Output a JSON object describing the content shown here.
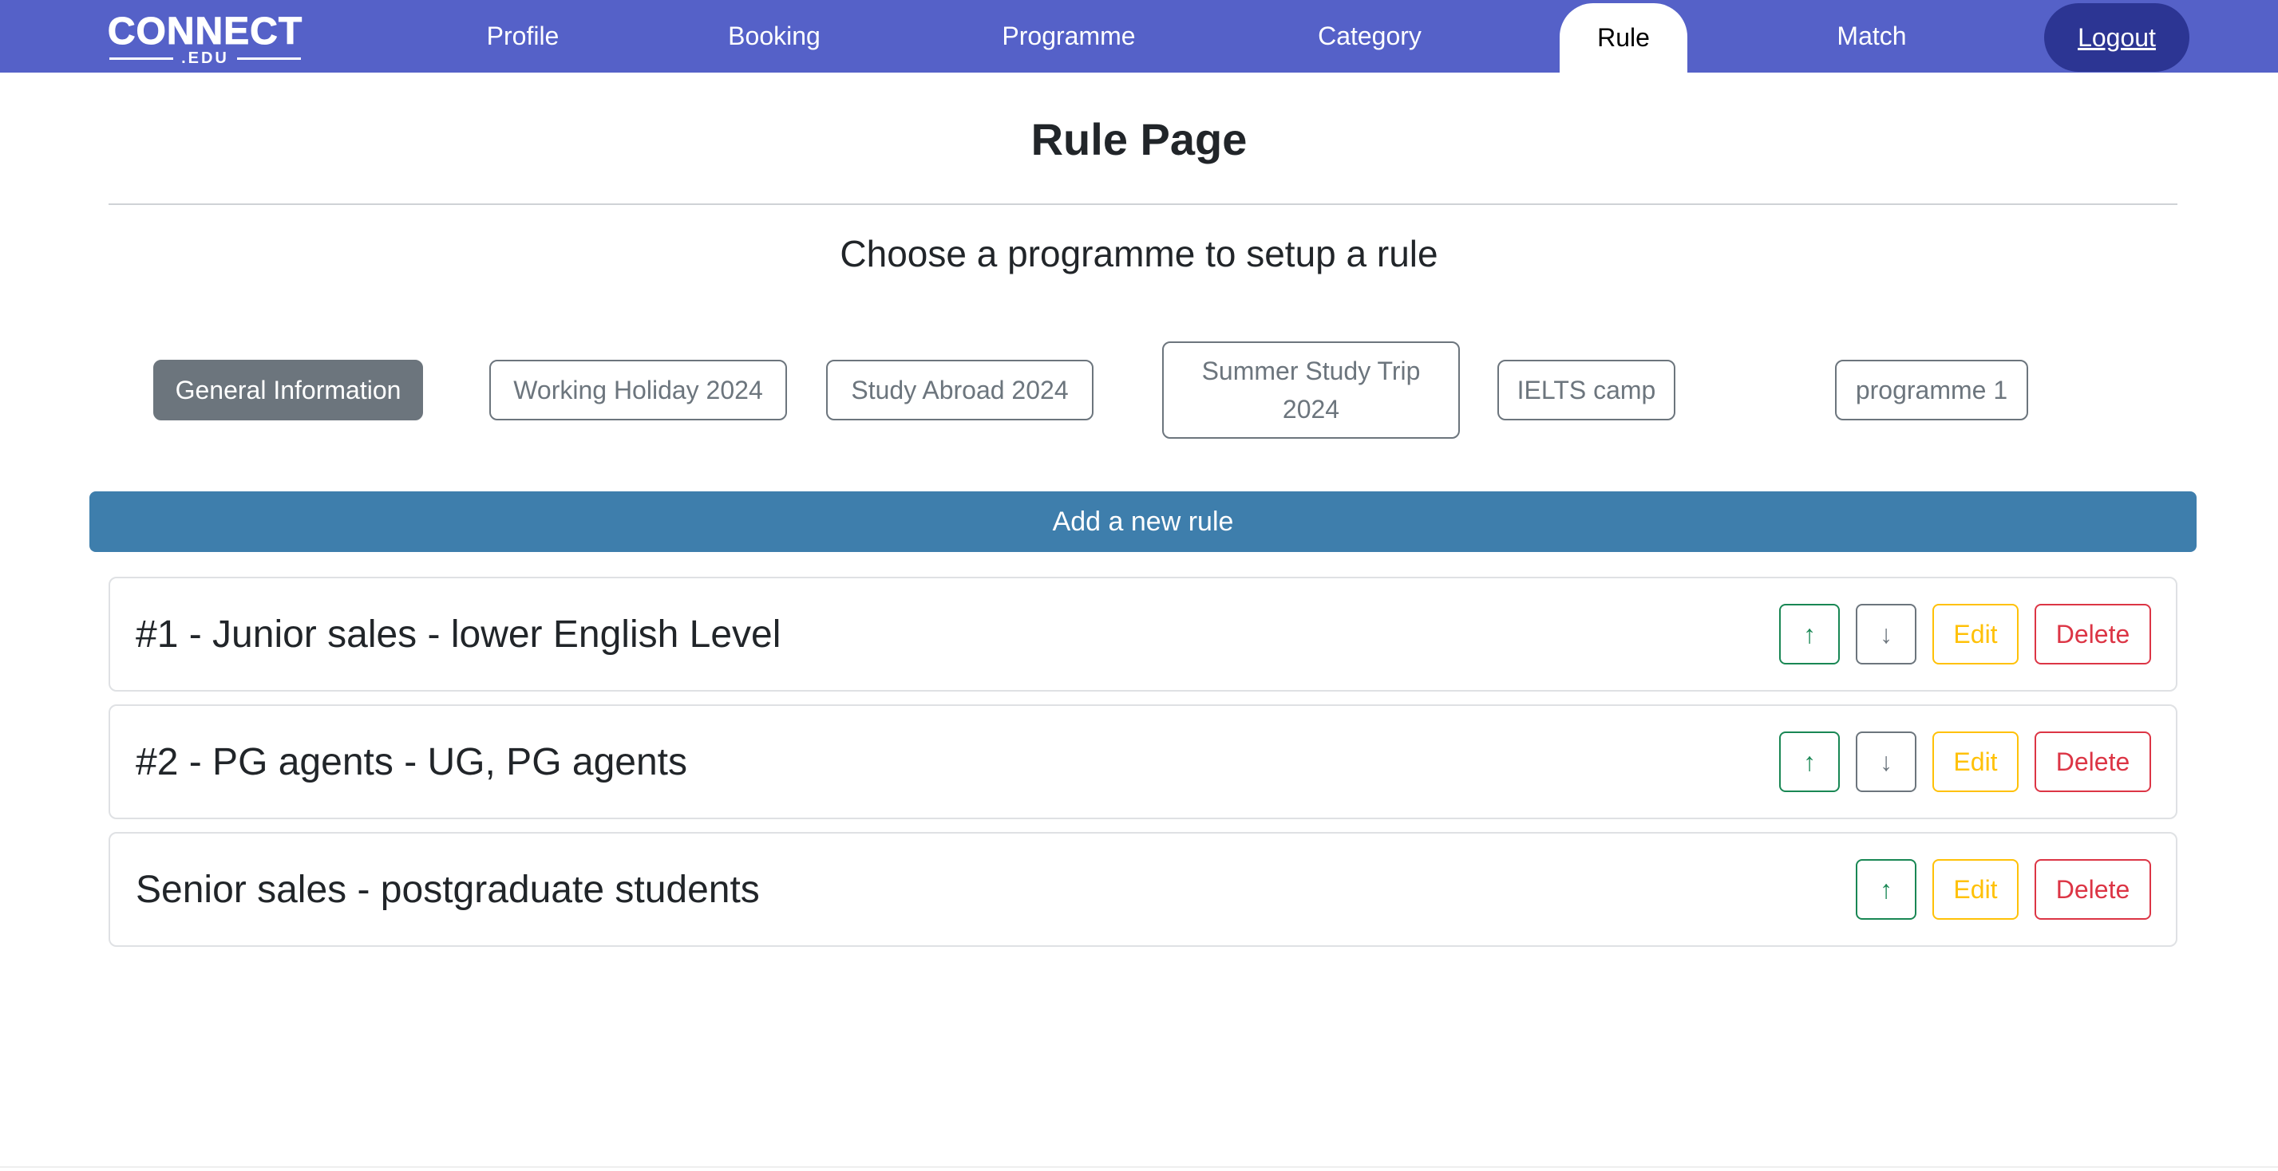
{
  "nav": {
    "logo_main": "CONNECT",
    "logo_sub": ".EDU",
    "items": [
      {
        "label": "Profile"
      },
      {
        "label": "Booking"
      },
      {
        "label": "Programme"
      },
      {
        "label": "Category"
      },
      {
        "label": "Rule",
        "active": true
      },
      {
        "label": "Match"
      }
    ],
    "logout_label": "Logout"
  },
  "page": {
    "title": "Rule Page",
    "subtitle": "Choose a programme to setup a rule"
  },
  "programmes": [
    {
      "label": "General Information",
      "active": true
    },
    {
      "label": "Working Holiday 2024"
    },
    {
      "label": "Study Abroad 2024"
    },
    {
      "label": "Summer Study Trip 2024"
    },
    {
      "label": "IELTS camp"
    },
    {
      "label": "programme 1"
    }
  ],
  "add_rule_label": "Add a new rule",
  "rules": [
    {
      "title": "#1 - Junior sales - lower English Level",
      "actions": [
        "up",
        "down",
        "edit",
        "delete"
      ]
    },
    {
      "title": "#2 - PG agents - UG, PG agents",
      "actions": [
        "up",
        "down",
        "edit",
        "delete"
      ]
    },
    {
      "title": "Senior sales - postgraduate students",
      "actions": [
        "up",
        "edit",
        "delete"
      ]
    }
  ],
  "action_labels": {
    "up": "↑",
    "down": "↓",
    "edit": "Edit",
    "delete": "Delete"
  },
  "icons": {
    "up": "arrow-up-icon",
    "down": "arrow-down-icon"
  },
  "colors": {
    "navbar": "#5561c8",
    "logout": "#2c3593",
    "add_rule": "#3e7eac",
    "up": "#198754",
    "down": "#6c757d",
    "edit": "#ffc107",
    "delete": "#dc3545"
  }
}
